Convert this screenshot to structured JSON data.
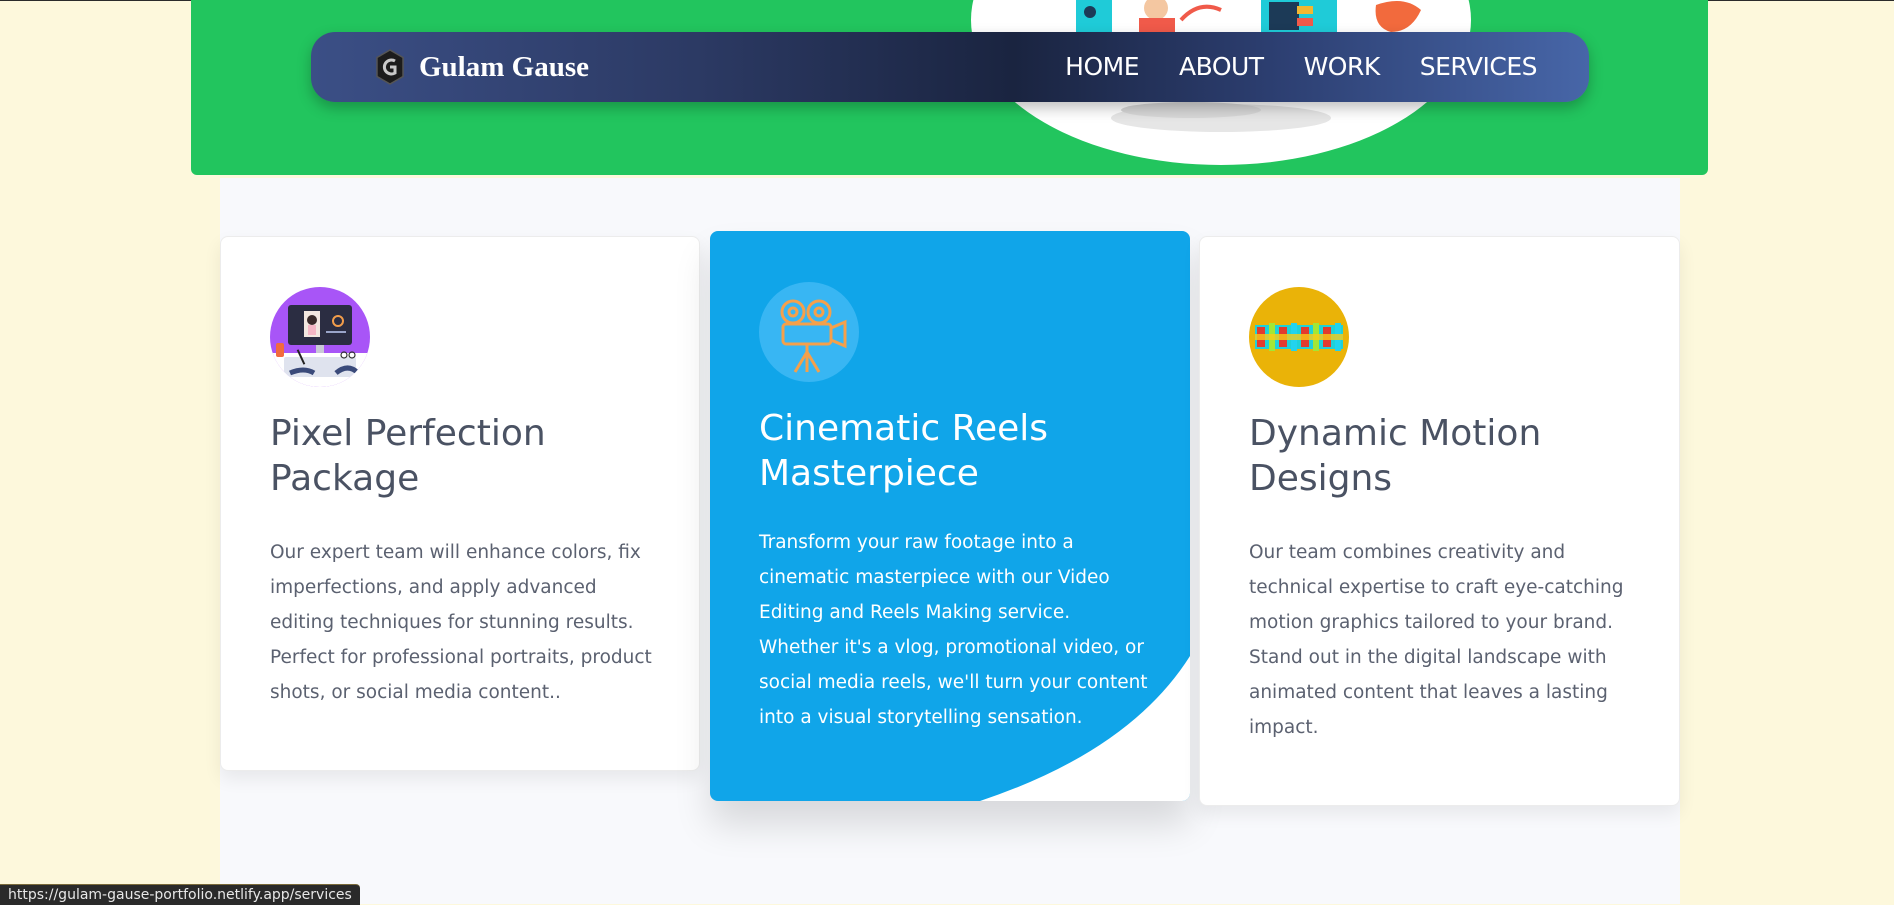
{
  "nav": {
    "brand": "Gulam Gause",
    "links": [
      "HOME",
      "ABOUT",
      "WORK",
      "SERVICES"
    ]
  },
  "services": [
    {
      "title": "Pixel Perfection Package",
      "description": "Our expert team will enhance colors, fix imperfections, and apply advanced editing techniques for stunning results. Perfect for professional portraits, product shots, or social media content..",
      "icon": "photo-editing-icon"
    },
    {
      "title": "Cinematic Reels Masterpiece",
      "description": "Transform your raw footage into a cinematic masterpiece with our Video Editing and Reels Making service. Whether it's a vlog, promotional video, or social media reels, we'll turn your content into a visual storytelling sensation.",
      "icon": "film-camera-icon"
    },
    {
      "title": "Dynamic Motion Designs",
      "description": "Our team combines creativity and technical expertise to craft eye-catching motion graphics tailored to your brand. Stand out in the digital landscape with animated content that leaves a lasting impact.",
      "icon": "motion-graphics-icon"
    }
  ],
  "status_bar": {
    "url": "https://gulam-gause-portfolio.netlify.app/services"
  },
  "colors": {
    "hero_green": "#22c55e",
    "active_card_blue": "#10a5e9",
    "page_background": "#fdf8dc"
  }
}
